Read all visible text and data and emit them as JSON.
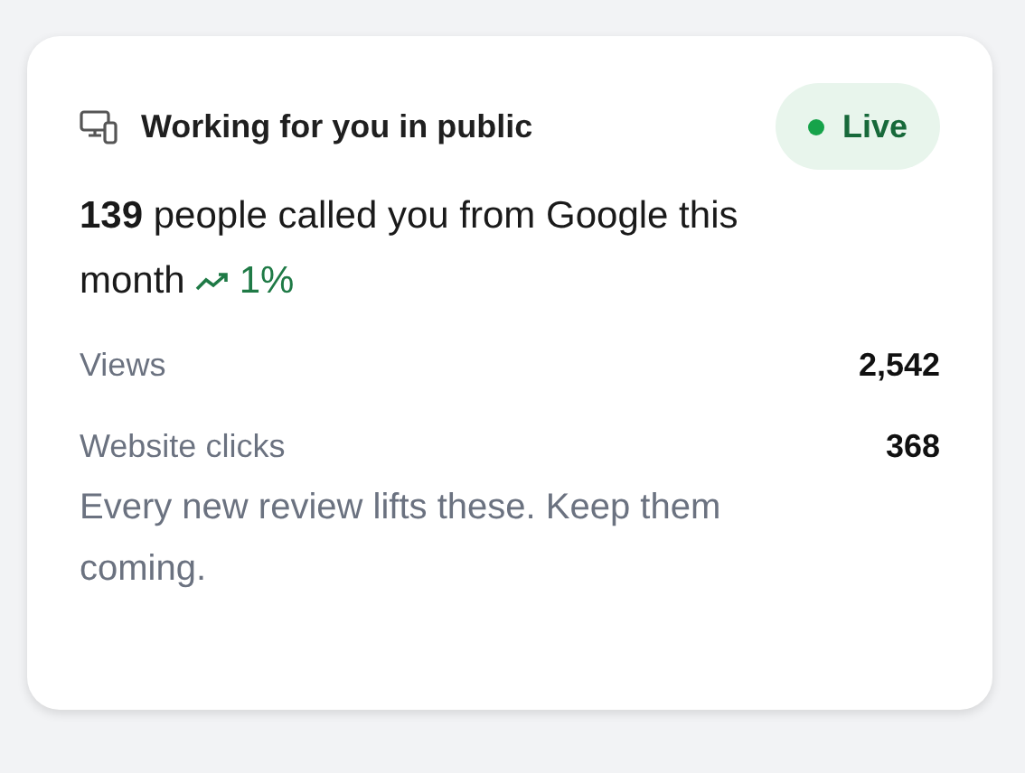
{
  "card": {
    "title": "Working for you in public",
    "status": {
      "label": "Live",
      "live": true
    },
    "headline": "**139** people called you from Google this month",
    "trend": {
      "rising": true,
      "value": "1%"
    },
    "stats": [
      {
        "label": "Views",
        "value": "2,542"
      },
      {
        "label": "Website clicks",
        "value": "368"
      }
    ],
    "note": "Every new review lifts these. Keep them coming."
  }
}
